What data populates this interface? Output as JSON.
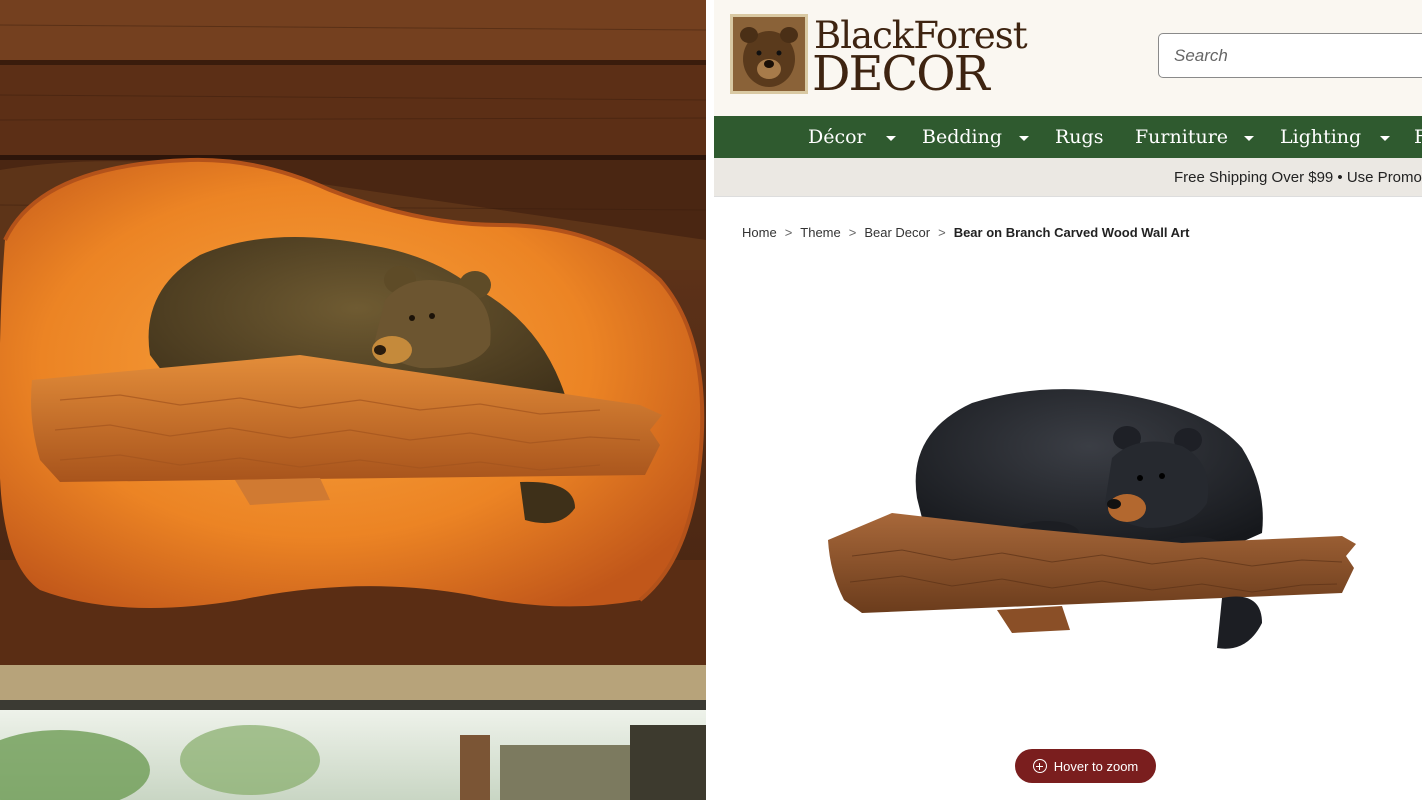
{
  "site": {
    "logo": {
      "line1": "BlackForest",
      "line2": "DECOR"
    },
    "search": {
      "placeholder": "Search"
    },
    "nav": {
      "items": [
        {
          "label": "Décor",
          "has_dropdown": true
        },
        {
          "label": "Bedding",
          "has_dropdown": true
        },
        {
          "label": "Rugs",
          "has_dropdown": false
        },
        {
          "label": "Furniture",
          "has_dropdown": true
        },
        {
          "label": "Lighting",
          "has_dropdown": true
        },
        {
          "label": "F",
          "has_dropdown": false
        }
      ]
    },
    "promo": {
      "text": "Free Shipping Over $99  •  Use Promo"
    },
    "breadcrumb": {
      "items": [
        "Home",
        "Theme",
        "Bear Decor"
      ],
      "current": "Bear on Branch Carved Wood Wall Art",
      "separator": ">"
    },
    "zoom_button": {
      "label": "Hover to zoom"
    },
    "colors": {
      "nav_bg": "#2f5a2f",
      "brand": "#3e2411",
      "zoom_bg": "#7a1e1e"
    }
  }
}
